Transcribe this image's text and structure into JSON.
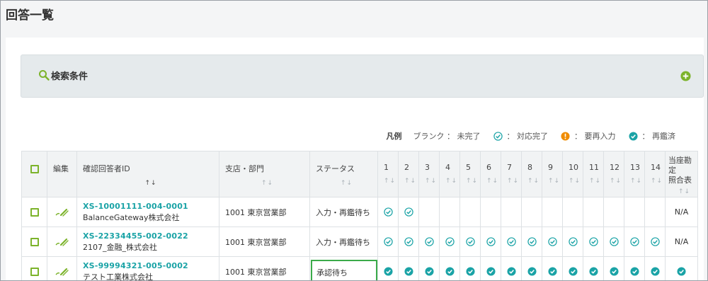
{
  "page": {
    "title": "回答一覧"
  },
  "search": {
    "label": "検索条件"
  },
  "legend": {
    "title": "凡例",
    "blank_label": "ブランク ： 未完了",
    "done_label": "： 対応完了",
    "reinput_label": "： 要再入力",
    "reconfirmed_label": "： 再鑑済"
  },
  "table": {
    "headers": {
      "edit": "編集",
      "id": "確認回答者ID",
      "branch": "支店・部門",
      "status": "ステータス",
      "nums": [
        "1",
        "2",
        "3",
        "4",
        "5",
        "6",
        "7",
        "8",
        "9",
        "10",
        "11",
        "12",
        "13",
        "14"
      ],
      "last_line1": "当座勘定",
      "last_line2": "照合表",
      "sort": "↑↓"
    },
    "rows": [
      {
        "id": "XS-10001111-004-0001",
        "company": "BalanceGateway株式会社",
        "branch": "1001 東京営業部",
        "status": "入力・再鑑待ち",
        "marks": [
          "done",
          "done",
          "",
          "",
          "",
          "",
          "",
          "",
          "",
          "",
          "",
          "",
          "",
          ""
        ],
        "last": "N/A"
      },
      {
        "id": "XS-22334455-002-0022",
        "company": "2107_金融_株式会社",
        "branch": "1001 東京営業部",
        "status": "入力・再鑑待ち",
        "marks": [
          "done",
          "done",
          "done",
          "done",
          "done",
          "done",
          "done",
          "done",
          "done",
          "done",
          "done",
          "done",
          "done",
          "done"
        ],
        "last": "N/A"
      },
      {
        "id": "XS-99994321-005-0002",
        "company": "テスト工業株式会社",
        "branch": "1001 東京営業部",
        "status": "承認待ち",
        "marks": [
          "reconfirmed",
          "reconfirmed",
          "reconfirmed",
          "reconfirmed",
          "reconfirmed",
          "reconfirmed",
          "reconfirmed",
          "reconfirmed",
          "reconfirmed",
          "reconfirmed",
          "reconfirmed",
          "reconfirmed",
          "reconfirmed",
          "reconfirmed"
        ],
        "last": "reconfirmed"
      }
    ]
  },
  "colors": {
    "accent": "#1aa3a6",
    "green": "#7cb32b",
    "warn": "#f08c00"
  }
}
